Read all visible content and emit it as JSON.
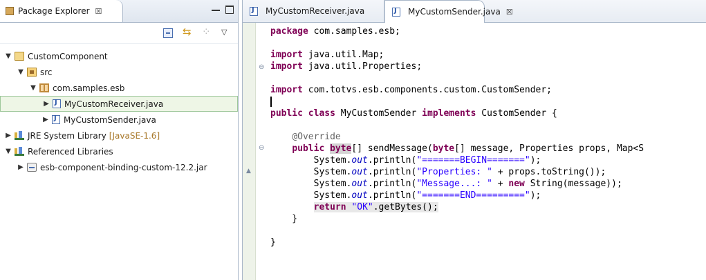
{
  "package_explorer": {
    "tab_label": "Package Explorer",
    "close_glyph": "☒",
    "tree": [
      {
        "label": "CustomComponent",
        "twisty": "▼",
        "icon": "project-icon",
        "level": 0
      },
      {
        "label": "src",
        "twisty": "▼",
        "icon": "source-folder-icon",
        "level": 1
      },
      {
        "label": "com.samples.esb",
        "twisty": "▼",
        "icon": "package-icon",
        "level": 2
      },
      {
        "label": "MyCustomReceiver.java",
        "twisty": "▶",
        "icon": "java-file-icon",
        "level": 3,
        "selected": true
      },
      {
        "label": "MyCustomSender.java",
        "twisty": "▶",
        "icon": "java-file-icon",
        "level": 3
      },
      {
        "label": "JRE System Library",
        "qualifier": "[JavaSE-1.6]",
        "twisty": "▶",
        "icon": "library-icon",
        "level": 0
      },
      {
        "label": "Referenced Libraries",
        "twisty": "▼",
        "icon": "library-icon",
        "level": 0
      },
      {
        "label": "esb-component-binding-custom-12.2.jar",
        "twisty": "▶",
        "icon": "jar-icon",
        "level": 1
      }
    ]
  },
  "editor": {
    "tabs": [
      {
        "label": "MyCustomReceiver.java",
        "active": false
      },
      {
        "label": "MyCustomSender.java",
        "active": true,
        "close_glyph": "☒"
      }
    ],
    "code_lines": [
      [
        {
          "t": "package",
          "c": "kw"
        },
        {
          "t": " com.samples.esb;"
        }
      ],
      [],
      [
        {
          "t": "import",
          "c": "kw"
        },
        {
          "t": " java.util.Map;"
        }
      ],
      [
        {
          "t": "import",
          "c": "kw"
        },
        {
          "t": " java.util.Properties;"
        }
      ],
      [],
      [
        {
          "t": "import",
          "c": "kw"
        },
        {
          "t": " com.totvs.esb.components.custom.CustomSender;"
        }
      ],
      [
        {
          "t": "",
          "c": "caret"
        }
      ],
      [
        {
          "t": "public",
          "c": "kw"
        },
        {
          "t": " "
        },
        {
          "t": "class",
          "c": "kw"
        },
        {
          "t": " MyCustomSender "
        },
        {
          "t": "implements",
          "c": "kw"
        },
        {
          "t": " CustomSender {"
        }
      ],
      [],
      [
        {
          "t": "    "
        },
        {
          "t": "@Override",
          "c": "ann"
        }
      ],
      [
        {
          "t": "    "
        },
        {
          "t": "public",
          "c": "kw"
        },
        {
          "t": " "
        },
        {
          "t": "byte",
          "c": "kw hl"
        },
        {
          "t": "[] sendMessage("
        },
        {
          "t": "byte",
          "c": "kw"
        },
        {
          "t": "[] message, Properties props, Map<S"
        }
      ],
      [
        {
          "t": "        System."
        },
        {
          "t": "out",
          "c": "static-field"
        },
        {
          "t": ".println("
        },
        {
          "t": "\"=======BEGIN=======\"",
          "c": "str"
        },
        {
          "t": ");"
        }
      ],
      [
        {
          "t": "        System."
        },
        {
          "t": "out",
          "c": "static-field"
        },
        {
          "t": ".println("
        },
        {
          "t": "\"Properties: \"",
          "c": "str"
        },
        {
          "t": " + props.toString());"
        }
      ],
      [
        {
          "t": "        System."
        },
        {
          "t": "out",
          "c": "static-field"
        },
        {
          "t": ".println("
        },
        {
          "t": "\"Message...: \"",
          "c": "str"
        },
        {
          "t": " + "
        },
        {
          "t": "new",
          "c": "kw"
        },
        {
          "t": " String(message));"
        }
      ],
      [
        {
          "t": "        System."
        },
        {
          "t": "out",
          "c": "static-field"
        },
        {
          "t": ".println("
        },
        {
          "t": "\"=======END=========\"",
          "c": "str"
        },
        {
          "t": ");"
        }
      ],
      [
        {
          "t": "        "
        },
        {
          "t": "return",
          "c": "kw hl-line"
        },
        {
          "t": " ",
          "c": "hl-line"
        },
        {
          "t": "\"OK\"",
          "c": "str hl-line"
        },
        {
          "t": ".getBytes();",
          "c": "hl-line"
        }
      ],
      [
        {
          "t": "    }"
        }
      ],
      [],
      [
        {
          "t": "}"
        }
      ]
    ]
  }
}
